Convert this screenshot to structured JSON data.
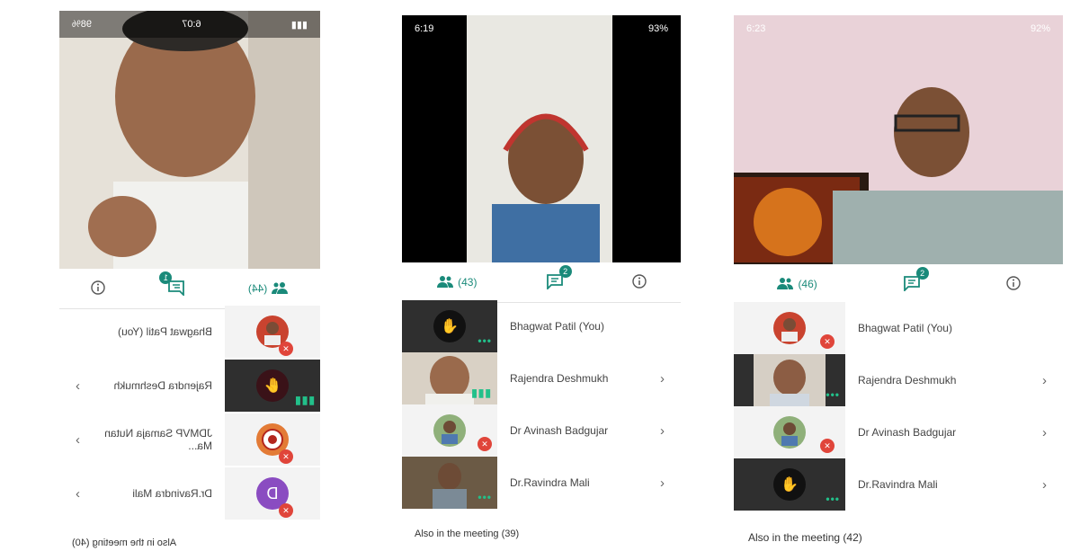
{
  "screens": [
    {
      "status": {
        "time": "6:07",
        "battery": "98%"
      },
      "tabs": {
        "participants": "(44)",
        "chat_badge": "1"
      },
      "participants": [
        {
          "name": "Bhagwat Patil (You)"
        },
        {
          "name": "Rajendra Deshmukh"
        },
        {
          "name": "JDMVP Samaja Nutan Ma..."
        },
        {
          "name": "Dr.Ravindra Mali",
          "initial": "D"
        }
      ],
      "also": "Also in the meeting (40)"
    },
    {
      "status": {
        "time": "6:19",
        "battery": "93%"
      },
      "tabs": {
        "participants": "(43)",
        "chat_badge": "2"
      },
      "participants": [
        {
          "name": "Bhagwat Patil (You)"
        },
        {
          "name": "Rajendra Deshmukh"
        },
        {
          "name": "Dr Avinash Badgujar"
        },
        {
          "name": "Dr.Ravindra Mali"
        }
      ],
      "also": "Also in the meeting (39)"
    },
    {
      "status": {
        "time": "6:23",
        "battery": "92%"
      },
      "tabs": {
        "participants": "(46)",
        "chat_badge": "2"
      },
      "participants": [
        {
          "name": "Bhagwat Patil (You)"
        },
        {
          "name": "Rajendra Deshmukh"
        },
        {
          "name": "Dr Avinash Badgujar"
        },
        {
          "name": "Dr.Ravindra Mali"
        }
      ],
      "also": "Also in the meeting (42)"
    }
  ],
  "colors": {
    "accent": "#1a8a7a",
    "muted_mic": "#e0453a",
    "speaking": "#22c08a"
  },
  "icons": [
    "participants-icon",
    "chat-icon",
    "info-icon",
    "mic-off-icon",
    "chevron-right-icon",
    "hand-raise-icon",
    "more-dots-icon"
  ]
}
